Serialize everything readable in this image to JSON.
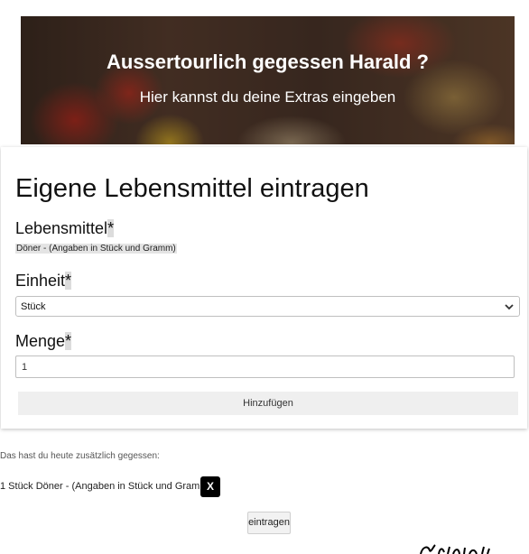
{
  "hero": {
    "title": "Aussertourlich gegessen Harald ?",
    "subtitle": "Hier kannst du deine Extras eingeben"
  },
  "form": {
    "title": "Eigene Lebensmittel eintragen",
    "food_label": "Lebensmittel",
    "food_value": "Döner - (Angaben in Stück und Gramm)",
    "unit_label": "Einheit",
    "unit_selected": "Stück",
    "amount_label": "Menge",
    "amount_value": "1",
    "required_marker": "*",
    "add_button": "Hinzufügen"
  },
  "summary": {
    "note": "Das hast du heute zusätzlich gegessen:",
    "entries": [
      {
        "text": "1 Stück Döner - (Angaben in Stück und Gramm)",
        "remove_label": "X"
      }
    ],
    "submit_button": "eintragen"
  },
  "icons": {
    "select_arrow": "chevron-down-icon"
  }
}
